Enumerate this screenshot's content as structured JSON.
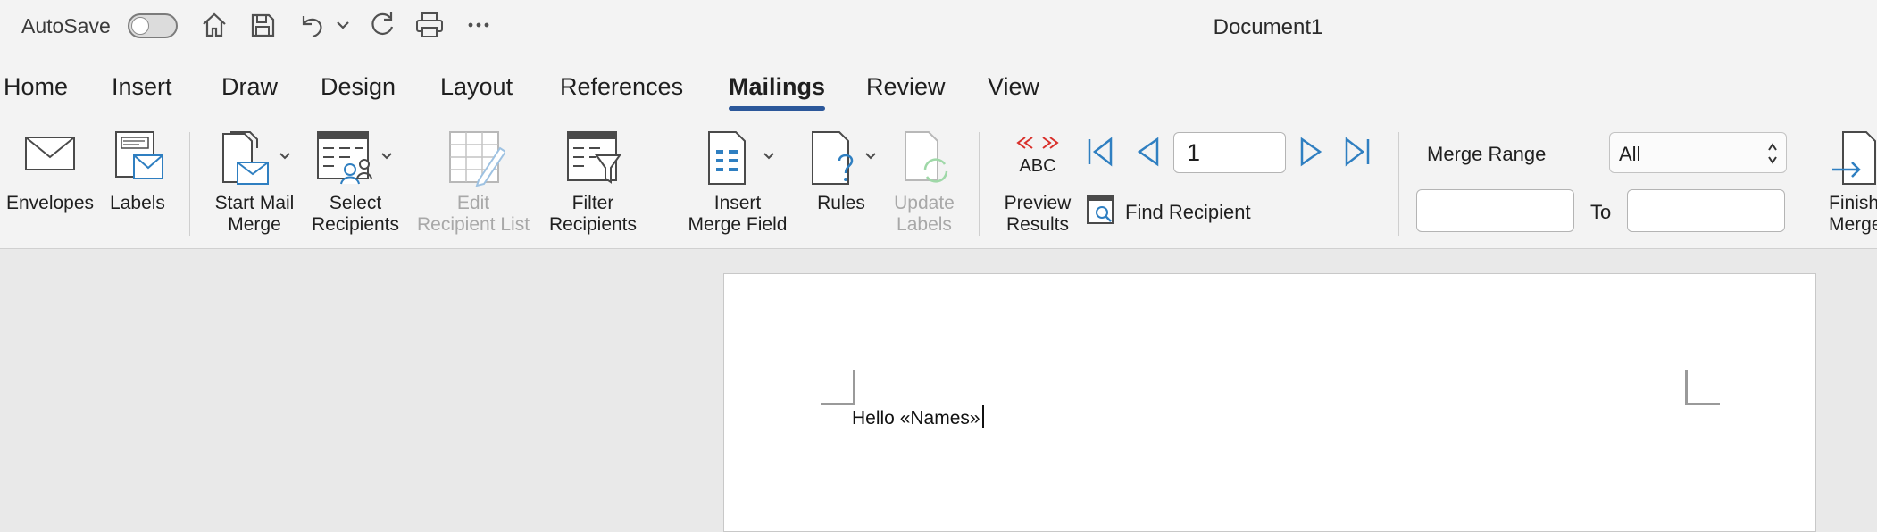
{
  "titlebar": {
    "autosave_label": "AutoSave",
    "autosave_state": "off",
    "document_title": "Document1",
    "icons": [
      "home-icon",
      "save-icon",
      "undo-icon",
      "chevron-down-icon",
      "redo-icon",
      "print-icon",
      "more-icon"
    ]
  },
  "tabs": [
    {
      "label": "Home",
      "active": false
    },
    {
      "label": "Insert",
      "active": false
    },
    {
      "label": "Draw",
      "active": false
    },
    {
      "label": "Design",
      "active": false
    },
    {
      "label": "Layout",
      "active": false
    },
    {
      "label": "References",
      "active": false
    },
    {
      "label": "Mailings",
      "active": true
    },
    {
      "label": "Review",
      "active": false
    },
    {
      "label": "View",
      "active": false
    }
  ],
  "ribbon": {
    "envelopes": "Envelopes",
    "labels": "Labels",
    "start_mail_merge": [
      "Start Mail",
      "Merge"
    ],
    "select_recipients": [
      "Select",
      "Recipients"
    ],
    "edit_recipient_list": [
      "Edit",
      "Recipient List"
    ],
    "filter_recipients": [
      "Filter",
      "Recipients"
    ],
    "insert_merge_field": [
      "Insert",
      "Merge Field"
    ],
    "rules": "Rules",
    "update_labels": [
      "Update",
      "Labels"
    ],
    "preview_results": [
      "Preview",
      "Results"
    ],
    "preview_abc": "ABC",
    "record_number": "1",
    "find_recipient": "Find Recipient",
    "merge_range_label": "Merge Range",
    "merge_range_value": "All",
    "to_label": "To",
    "finish_merge": [
      "Finish &",
      "Merge"
    ]
  },
  "document": {
    "text": "Hello «Names»"
  },
  "colors": {
    "accent": "#2b579a",
    "icon_blue": "#2f7fc1",
    "red": "#d9302b"
  }
}
